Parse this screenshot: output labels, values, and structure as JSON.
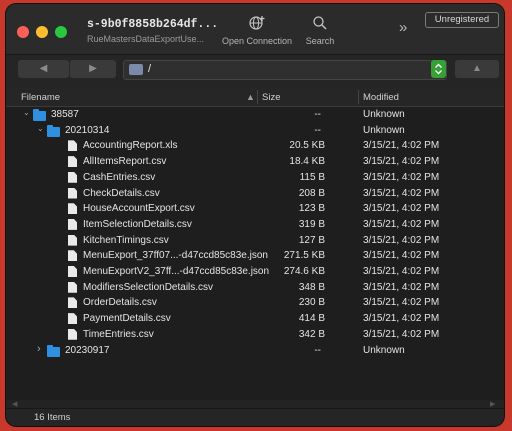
{
  "window": {
    "title": "s-9b0f8858b264df...",
    "subtitle": "RueMastersDataExportUse..."
  },
  "toolbar": {
    "open_connection_label": "Open Connection",
    "search_label": "Search",
    "more_glyph": "»",
    "unregistered_label": "Unregistered"
  },
  "nav": {
    "back_glyph": "◀",
    "forward_glyph": "▶",
    "path": "/",
    "up_glyph": "▲",
    "picker_glyph": "⌃⌄"
  },
  "columns": {
    "filename": "Filename",
    "size": "Size",
    "modified": "Modified"
  },
  "rows": [
    {
      "name": "38587",
      "size": "--",
      "modified": "Unknown",
      "type": "folder",
      "level": 0,
      "disclosure": "expanded"
    },
    {
      "name": "20210314",
      "size": "--",
      "modified": "Unknown",
      "type": "folder",
      "level": 1,
      "disclosure": "expanded"
    },
    {
      "name": "AccountingReport.xls",
      "size": "20.5 KB",
      "modified": "3/15/21, 4:02 PM",
      "type": "file",
      "level": 2
    },
    {
      "name": "AllItemsReport.csv",
      "size": "18.4 KB",
      "modified": "3/15/21, 4:02 PM",
      "type": "file",
      "level": 2
    },
    {
      "name": "CashEntries.csv",
      "size": "115 B",
      "modified": "3/15/21, 4:02 PM",
      "type": "file",
      "level": 2
    },
    {
      "name": "CheckDetails.csv",
      "size": "208 B",
      "modified": "3/15/21, 4:02 PM",
      "type": "file",
      "level": 2
    },
    {
      "name": "HouseAccountExport.csv",
      "size": "123 B",
      "modified": "3/15/21, 4:02 PM",
      "type": "file",
      "level": 2
    },
    {
      "name": "ItemSelectionDetails.csv",
      "size": "319 B",
      "modified": "3/15/21, 4:02 PM",
      "type": "file",
      "level": 2
    },
    {
      "name": "KitchenTimings.csv",
      "size": "127 B",
      "modified": "3/15/21, 4:02 PM",
      "type": "file",
      "level": 2
    },
    {
      "name": "MenuExport_37ff07...-d47ccd85c83e.json",
      "size": "271.5 KB",
      "modified": "3/15/21, 4:02 PM",
      "type": "file",
      "level": 2
    },
    {
      "name": "MenuExportV2_37ff...-d47ccd85c83e.json",
      "size": "274.6 KB",
      "modified": "3/15/21, 4:02 PM",
      "type": "file",
      "level": 2
    },
    {
      "name": "ModifiersSelectionDetails.csv",
      "size": "348 B",
      "modified": "3/15/21, 4:02 PM",
      "type": "file",
      "level": 2
    },
    {
      "name": "OrderDetails.csv",
      "size": "230 B",
      "modified": "3/15/21, 4:02 PM",
      "type": "file",
      "level": 2
    },
    {
      "name": "PaymentDetails.csv",
      "size": "414 B",
      "modified": "3/15/21, 4:02 PM",
      "type": "file",
      "level": 2
    },
    {
      "name": "TimeEntries.csv",
      "size": "342 B",
      "modified": "3/15/21, 4:02 PM",
      "type": "file",
      "level": 2
    },
    {
      "name": "20230917",
      "size": "--",
      "modified": "Unknown",
      "type": "folder",
      "level": 1,
      "disclosure": "collapsed"
    }
  ],
  "status": {
    "item_count": "16 Items"
  },
  "colors": {
    "folder": "#2f8fe0",
    "window_bg": "#1e1e1e",
    "frame": "#c8392c"
  }
}
